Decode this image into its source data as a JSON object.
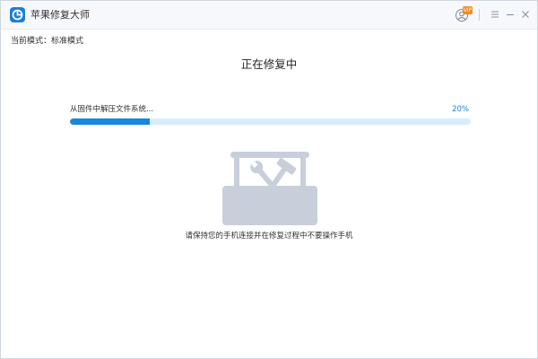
{
  "app": {
    "title": "苹果修复大师",
    "vip_badge": "VIP"
  },
  "mode": {
    "label": "当前模式：标准模式"
  },
  "main": {
    "title": "正在修复中",
    "step_text": "从固件中解压文件系统...",
    "progress_text": "20%",
    "progress": 0.2,
    "hint": "请保持您的手机连接并在修复过程中不要操作手机"
  },
  "colors": {
    "accent": "#1787e0",
    "progress_track": "#d8ecfb",
    "illustration": "#c8cfda"
  },
  "icons": {
    "app": "app-logo-icon",
    "user": "user-icon",
    "menu": "menu-icon",
    "minimize": "minimize-icon",
    "close": "close-icon",
    "toolbox": "toolbox-icon"
  }
}
